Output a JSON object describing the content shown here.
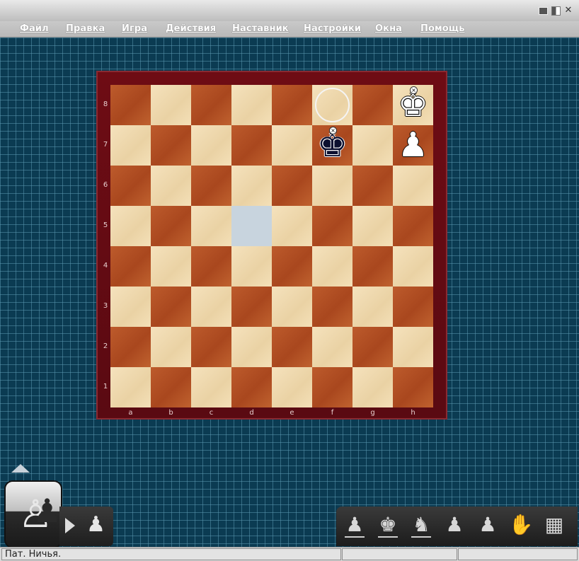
{
  "menu": {
    "items": [
      {
        "label": "Файл"
      },
      {
        "label": "Правка"
      },
      {
        "label": "Игра"
      },
      {
        "label": "Действия"
      },
      {
        "label": "Наставник"
      },
      {
        "label": "Настройки"
      },
      {
        "label": "Окна"
      },
      {
        "label": "Помощь"
      }
    ]
  },
  "board": {
    "files": [
      "a",
      "b",
      "c",
      "d",
      "e",
      "f",
      "g",
      "h"
    ],
    "ranks": [
      "8",
      "7",
      "6",
      "5",
      "4",
      "3",
      "2",
      "1"
    ],
    "bottom_left_square_color": "dark",
    "highlighted_square": "d5",
    "ring_marker_square": "f8",
    "pieces": [
      {
        "square": "h8",
        "type": "king",
        "color": "white",
        "glyph": "♚",
        "icon": "white-king-icon",
        "marker": true
      },
      {
        "square": "f7",
        "type": "king",
        "color": "black",
        "glyph": "♚",
        "icon": "black-king-icon",
        "marker": true
      },
      {
        "square": "h7",
        "type": "pawn",
        "color": "white",
        "glyph": "♟",
        "icon": "white-pawn-icon",
        "marker": false
      }
    ],
    "colors": {
      "frame": "#6e0c14",
      "light_square": "#f0dcb3",
      "dark_square": "#b5532a",
      "highlight": "#c8d4de"
    }
  },
  "toolbar": {
    "tools": [
      {
        "icon": "pawn-icon",
        "glyph": "♟"
      },
      {
        "icon": "kings-icon",
        "glyph": "♚"
      },
      {
        "icon": "hint-icon",
        "glyph": "♞"
      },
      {
        "icon": "undo-move-icon",
        "glyph": "♟"
      },
      {
        "icon": "pawns-row-icon",
        "glyph": "♟"
      },
      {
        "icon": "hand-icon",
        "glyph": "✋"
      },
      {
        "icon": "board-icon",
        "glyph": "▦"
      }
    ]
  },
  "left_widget": {
    "avatar_icon": "chess-pieces-avatar-icon",
    "play_icon": "play-icon",
    "pawn_icon": "pawn-icon"
  },
  "status": {
    "text": "Пат. Ничья."
  }
}
